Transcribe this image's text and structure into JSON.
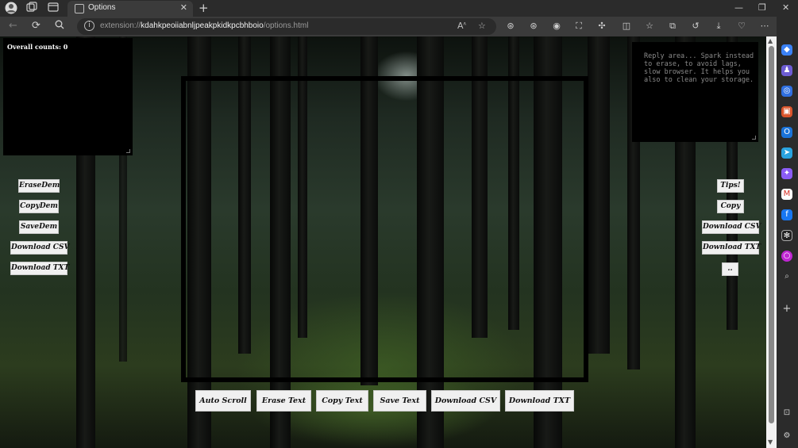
{
  "browser": {
    "tab_title": "Options",
    "tab_close": "✕",
    "new_tab": "+",
    "url_scheme": "extension://",
    "url_host": "kdahkpeoiiabnljpeakpkidkpcbhboio",
    "url_path": "/options.html",
    "window_controls": {
      "minimize": "—",
      "maximize": "❐",
      "close": "✕"
    }
  },
  "page": {
    "overall_counts": "Overall counts: 0",
    "reply_placeholder": "Reply area... Spark instead to erase, to avoid lags, slow browser. It helps you also to clean your storage."
  },
  "left_buttons": [
    "EraseDem",
    "CopyDem",
    "SaveDem",
    "Download CSV",
    "Download TXT"
  ],
  "right_buttons": [
    "Tips!",
    "Copy",
    "Download CSV",
    "Download TXT",
    ".."
  ],
  "bottom_buttons": [
    "Auto Scroll",
    "Erase Text",
    "Copy Text",
    "Save Text",
    "Download CSV",
    "Download TXT"
  ],
  "theme": {
    "accent_edge": "#3b82f6",
    "button_bg": "#f0f0f0",
    "panel_bg": "#000000"
  }
}
